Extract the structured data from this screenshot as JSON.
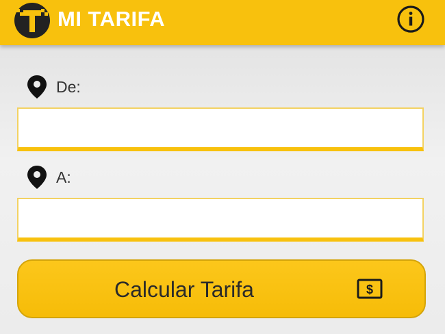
{
  "app_bar": {
    "title": "MI TARIFA",
    "logo_icon": "taxi-logo-icon",
    "info_icon": "info-icon",
    "color": "#f8c10d"
  },
  "form": {
    "origin": {
      "label": "De:",
      "icon": "location-pin-icon",
      "value": ""
    },
    "destination": {
      "label": "A:",
      "icon": "location-pin-icon",
      "value": ""
    }
  },
  "calculate_button": {
    "label": "Calcular Tarifa",
    "icon": "money-icon"
  }
}
